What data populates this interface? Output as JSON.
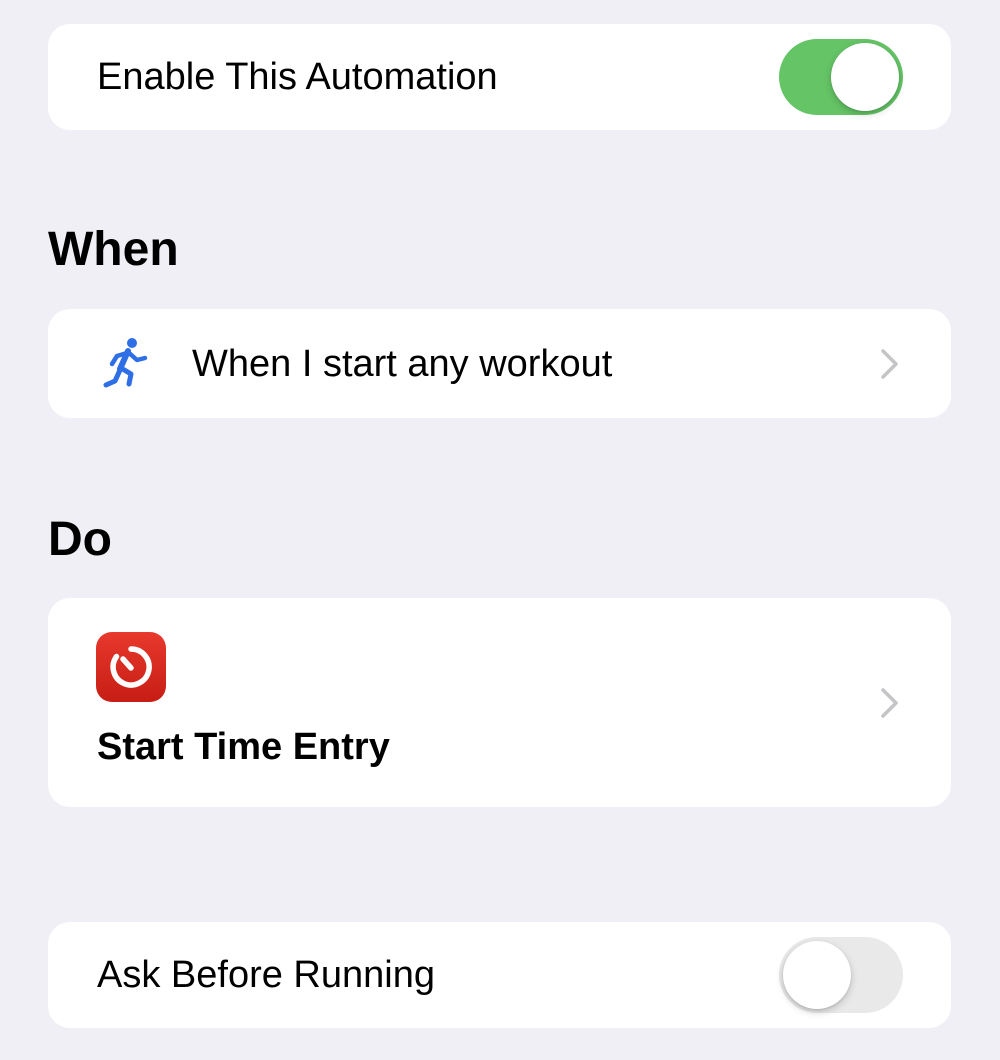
{
  "enable_row": {
    "label": "Enable This Automation",
    "toggle_state": "on"
  },
  "when_section": {
    "title": "When",
    "trigger": {
      "label": "When I start any workout",
      "icon": "running-figure-icon"
    }
  },
  "do_section": {
    "title": "Do",
    "action": {
      "label": "Start Time Entry",
      "icon": "timer-app-icon"
    }
  },
  "ask_row": {
    "label": "Ask Before Running",
    "toggle_state": "off"
  },
  "colors": {
    "background": "#f0eff5",
    "toggle_on": "#65c466",
    "toggle_off": "#e9e9ea",
    "accent_blue": "#2f6fe6",
    "app_icon_red": "#d8271d",
    "chevron": "#c4c4c7"
  }
}
